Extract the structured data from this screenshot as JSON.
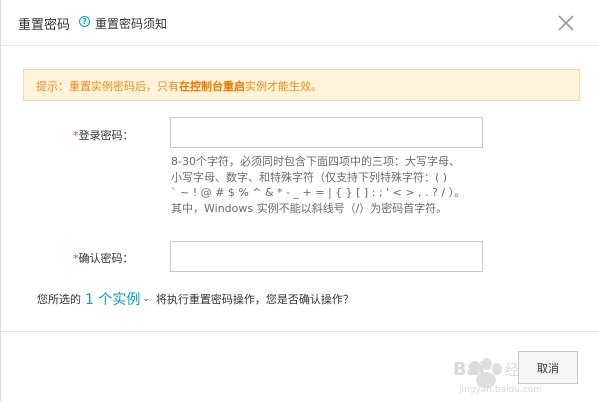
{
  "header": {
    "title": "重置密码",
    "help_icon_glyph": "?",
    "help_link": "重置密码须知",
    "close_icon": "close-icon"
  },
  "alert": {
    "prefix": "提示：重置实例密码后，只有",
    "emphasis": "在控制台重启",
    "suffix": "实例才能生效。"
  },
  "form": {
    "login_password": {
      "required_mark": "*",
      "label": "登录密码：",
      "value": ""
    },
    "hint_lines": [
      "8-30个字符，必须同时包含下面四项中的三项：大写字母、",
      "小写字母、数字、和特殊字符（仅支持下列特殊字符：( )",
      "` ~ ! @ # $ % ^ & * - _ + = | { } [ ] : ; ' < > , . ? / ）。",
      "其中，Windows 实例不能以斜线号（/）为密码首字符。"
    ],
    "confirm_password": {
      "required_mark": "*",
      "label": "确认密码：",
      "value": ""
    }
  },
  "instance": {
    "prefix": "您所选的",
    "link": "1 个实例",
    "caret": "⌄",
    "suffix": "将执行重置密码操作，您是否确认操作？"
  },
  "footer": {
    "cancel_label": "取消"
  },
  "colors": {
    "accent": "#00a2ca",
    "alert_bg": "#fff3d9",
    "alert_text": "#f08c1e",
    "required": "#e84e0f"
  }
}
